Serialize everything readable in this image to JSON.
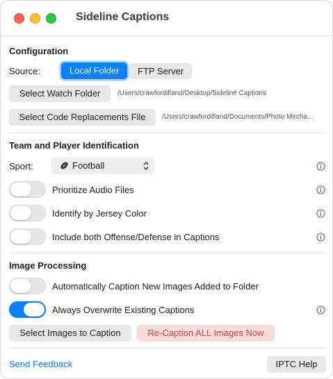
{
  "window": {
    "title": "Sideline Captions"
  },
  "configuration": {
    "title": "Configuration",
    "source_label": "Source:",
    "source_options": [
      "Local Folder",
      "FTP Server"
    ],
    "source_selected": "Local Folder",
    "watch_folder_button": "Select Watch Folder",
    "watch_folder_path": "/Users/crawfordifland/Desktop/Sideline Captions",
    "code_replacements_button": "Select Code Replacements File",
    "code_replacements_path": "/Users/crawfordifland/Documents/Photo Mecha..."
  },
  "team": {
    "title": "Team and Player Identification",
    "sport_label": "Sport:",
    "sport_value": "Football",
    "toggles": [
      {
        "label": "Prioritize Audio Files",
        "on": false
      },
      {
        "label": "Identify by Jersey Color",
        "on": false
      },
      {
        "label": "Include both Offense/Defense in Captions",
        "on": false
      }
    ]
  },
  "image_processing": {
    "title": "Image Processing",
    "toggles": [
      {
        "label": "Automatically Caption New Images Added to Folder",
        "on": false
      },
      {
        "label": "Always Overwrite Existing Captions",
        "on": true
      }
    ],
    "select_images_button": "Select Images to Caption",
    "recaption_button": "Re-Caption ALL Images Now"
  },
  "footer": {
    "feedback_link": "Send Feedback",
    "help_button": "IPTC Help"
  },
  "colors": {
    "accent": "#0a82ff",
    "danger_text": "#e3443c",
    "danger_bg": "#fbdcdc",
    "toggle_off": "#e6e6e6"
  },
  "icons": {
    "info": "info-circle-icon",
    "sport": "football-icon",
    "select": "chevron-up-down-icon"
  }
}
